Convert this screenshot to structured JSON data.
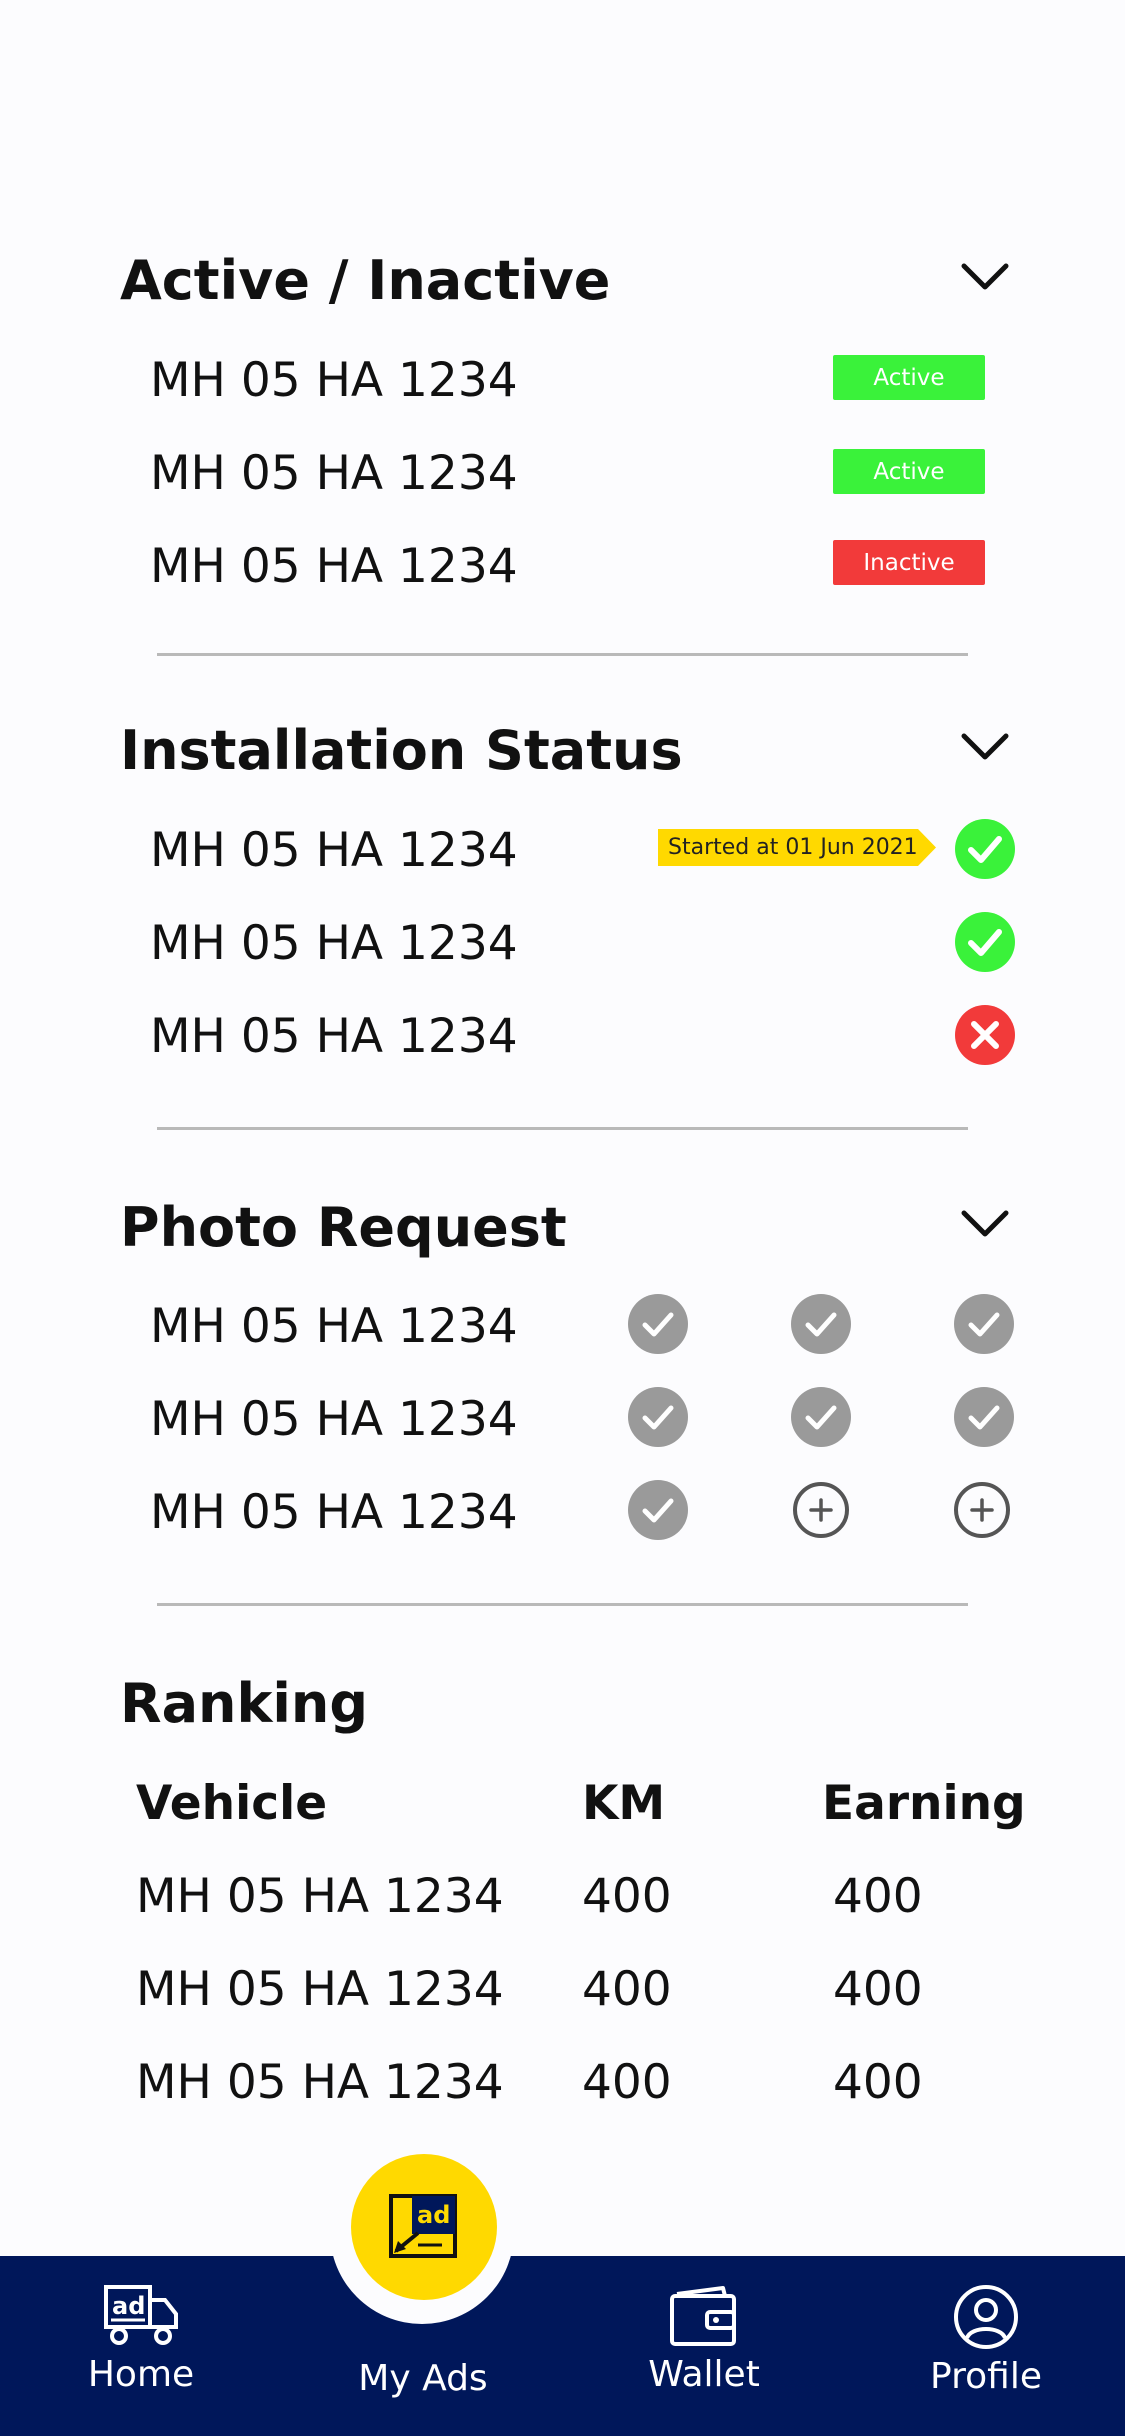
{
  "sections": {
    "active": {
      "title": "Active / Inactive",
      "rows": [
        {
          "vehicle": "MH 05 HA 1234",
          "status": "Active",
          "color": "#3af23a"
        },
        {
          "vehicle": "MH 05 HA 1234",
          "status": "Active",
          "color": "#3af23a"
        },
        {
          "vehicle": "MH 05 HA 1234",
          "status": "Inactive",
          "color": "#f23a3a"
        }
      ]
    },
    "installation": {
      "title": "Installation Status",
      "rows": [
        {
          "vehicle": "MH 05 HA 1234",
          "tag": "Started at 01 Jun 2021",
          "icon": "check-green"
        },
        {
          "vehicle": "MH 05 HA 1234",
          "icon": "check-green"
        },
        {
          "vehicle": "MH 05 HA 1234",
          "icon": "cross-red"
        }
      ]
    },
    "photo": {
      "title": "Photo Request",
      "rows": [
        {
          "vehicle": "MH 05 HA 1234",
          "icons": [
            "check-gray",
            "check-gray",
            "check-gray"
          ]
        },
        {
          "vehicle": "MH 05 HA 1234",
          "icons": [
            "check-gray",
            "check-gray",
            "check-gray"
          ]
        },
        {
          "vehicle": "MH 05 HA 1234",
          "icons": [
            "check-gray",
            "plus-outline",
            "plus-outline"
          ]
        }
      ]
    },
    "ranking": {
      "title": "Ranking",
      "headers": [
        "Vehicle",
        "KM",
        "Earning"
      ],
      "rows": [
        [
          "MH 05 HA 1234",
          "400",
          "400"
        ],
        [
          "MH 05 HA 1234",
          "400",
          "400"
        ],
        [
          "MH 05 HA 1234",
          "400",
          "400"
        ]
      ]
    }
  },
  "nav": {
    "home": "Home",
    "myads": "My Ads",
    "wallet": "Wallet",
    "profile": "Profile",
    "fab_icon": "ad-icon"
  },
  "colors": {
    "navbar": "#00175a",
    "fab": "#ffd900",
    "tag": "#ffd900",
    "green": "#3af23a",
    "red": "#f23a3a",
    "gray": "#9a9a9a"
  }
}
